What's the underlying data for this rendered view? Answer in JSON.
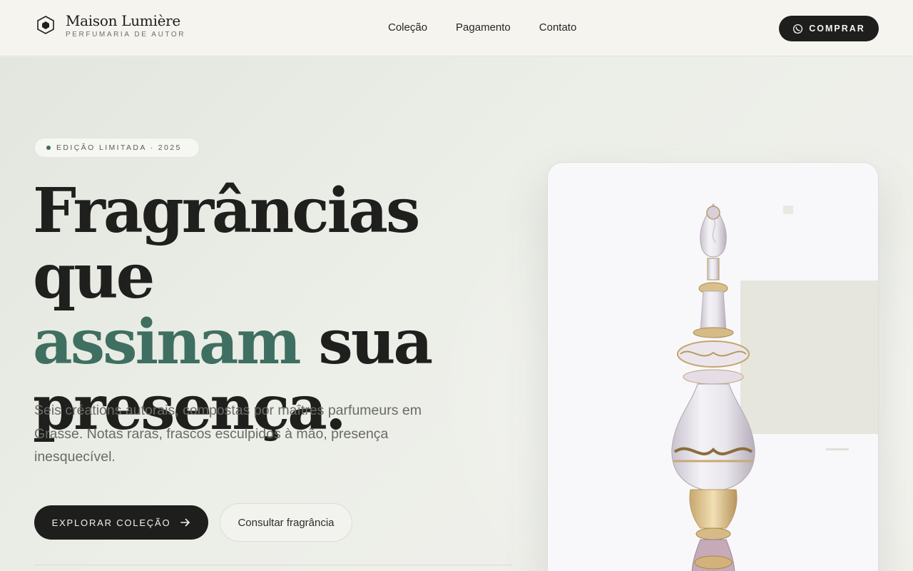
{
  "header": {
    "brand_name": "Maison Lumière",
    "brand_tagline": "PERFUMARIA DE AUTOR",
    "nav": [
      "Coleção",
      "Pagamento",
      "Contato"
    ],
    "buy_label": "COMPRAR"
  },
  "hero": {
    "badge": "EDIÇÃO LIMITADA · 2025",
    "headline_part1": "Fragrâncias que",
    "headline_accent": "assinam",
    "headline_part2": " sua",
    "headline_part3": "presença.",
    "lead": "Seis créations autorais, compostas por maîtres parfumeurs em Grasse. Notas raras, frascos esculpidos à mão, presença inesquecível.",
    "primary_cta": "EXPLORAR COLEÇÃO",
    "secondary_cta": "Consultar fragrância"
  },
  "colors": {
    "accent": "#3f6f60",
    "dark": "#1e1e1c",
    "background": "#eceee8"
  },
  "icons": {
    "logo": "hexagon-logo-icon",
    "buy": "whatsapp-icon",
    "arrow": "arrow-right-icon"
  }
}
